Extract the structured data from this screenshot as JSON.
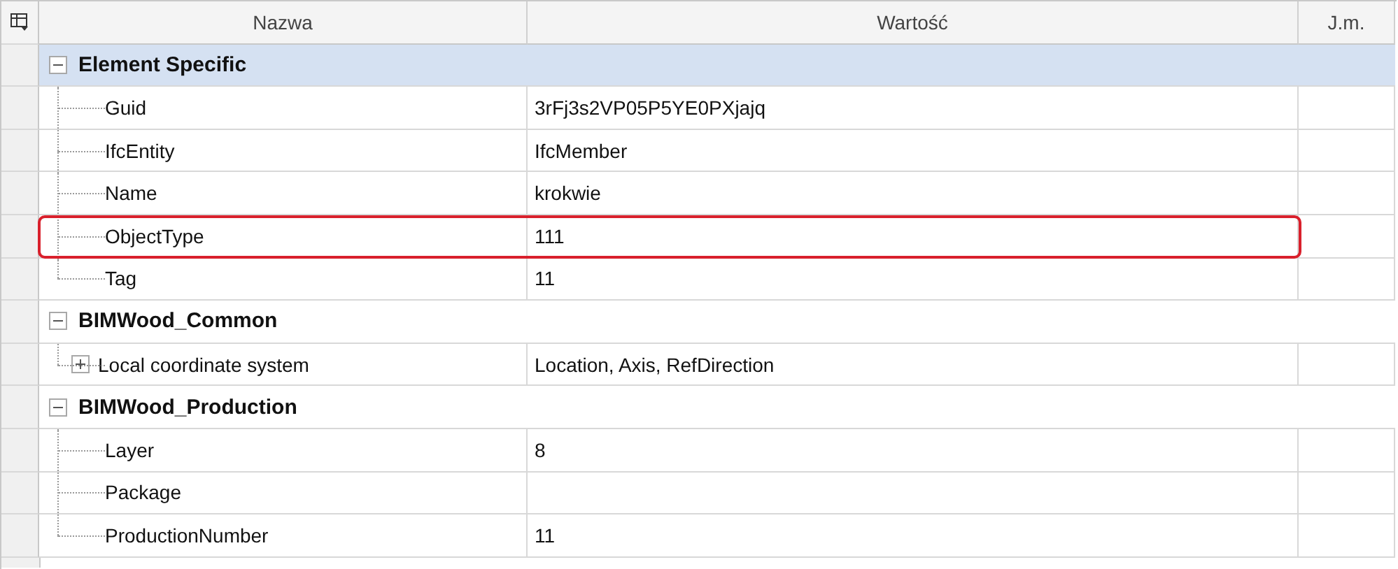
{
  "columns": [
    {
      "label": "Nazwa"
    },
    {
      "label": "Wartość"
    },
    {
      "label": "J.m."
    }
  ],
  "groups": [
    {
      "name": "Element Specific",
      "expanded": true,
      "selected": true,
      "rows": [
        {
          "name": "Guid",
          "value": "3rFj3s2VP05P5YE0PXjajq",
          "highlighted": false
        },
        {
          "name": "IfcEntity",
          "value": "IfcMember",
          "highlighted": false
        },
        {
          "name": "Name",
          "value": "krokwie",
          "highlighted": false
        },
        {
          "name": "ObjectType",
          "value": "111",
          "highlighted": true
        },
        {
          "name": "Tag",
          "value": "11",
          "highlighted": false
        }
      ]
    },
    {
      "name": "BIMWood_Common",
      "expanded": true,
      "selected": false,
      "rows": [
        {
          "name": "Local coordinate system",
          "value": "Location, Axis, RefDirection",
          "highlighted": false,
          "expanded": false
        }
      ]
    },
    {
      "name": "BIMWood_Production",
      "expanded": true,
      "selected": false,
      "rows": [
        {
          "name": "Layer",
          "value": "8",
          "highlighted": false
        },
        {
          "name": "Package",
          "highlighted": false
        },
        {
          "name": "ProductionNumber",
          "value": "11",
          "highlighted": false
        }
      ]
    }
  ]
}
